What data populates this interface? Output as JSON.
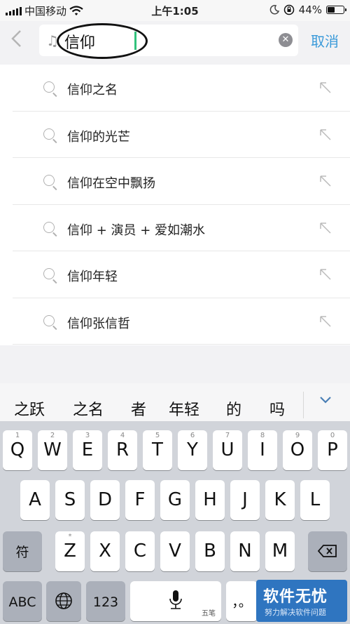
{
  "status_bar": {
    "carrier": "中国移动",
    "time": "上午1:05",
    "battery": "44%",
    "battery_level": 0.44
  },
  "search": {
    "query": "信仰",
    "cancel_label": "取消",
    "clear_icon": "clear-x-icon",
    "music_icon": "music-note-icon"
  },
  "suggestions": [
    {
      "label": "信仰之名"
    },
    {
      "label": "信仰的光芒"
    },
    {
      "label": "信仰在空中飘扬"
    },
    {
      "label": "信仰 + 演员 + 爱如潮水"
    },
    {
      "label": "信仰年轻"
    },
    {
      "label": "信仰张信哲"
    }
  ],
  "candidates": [
    "之跃",
    "之名",
    "者",
    "年轻",
    "的",
    "吗"
  ],
  "keyboard": {
    "row1": [
      {
        "k": "Q",
        "n": "1"
      },
      {
        "k": "W",
        "n": "2"
      },
      {
        "k": "E",
        "n": "3"
      },
      {
        "k": "R",
        "n": "4"
      },
      {
        "k": "T",
        "n": "5"
      },
      {
        "k": "Y",
        "n": "6"
      },
      {
        "k": "U",
        "n": "7"
      },
      {
        "k": "I",
        "n": "8"
      },
      {
        "k": "O",
        "n": "9"
      },
      {
        "k": "P",
        "n": "0"
      }
    ],
    "row2": [
      "A",
      "S",
      "D",
      "F",
      "G",
      "H",
      "J",
      "K",
      "L"
    ],
    "row3": [
      {
        "k": "Z",
        "n": "*"
      },
      {
        "k": "X",
        "n": ""
      },
      {
        "k": "C",
        "n": ""
      },
      {
        "k": "V",
        "n": ""
      },
      {
        "k": "B",
        "n": ""
      },
      {
        "k": "N",
        "n": ""
      },
      {
        "k": "M",
        "n": ""
      }
    ],
    "shift_label": "符",
    "abc_label": "ABC",
    "num_label": "123",
    "space_label": "五笔",
    "punct_label": "，。"
  },
  "watermark": {
    "title": "软件无忧",
    "subtitle": "努力解决软件问题"
  },
  "colors": {
    "accent": "#3a9ad9",
    "caret": "#31c27c",
    "keyboard_bg": "#d1d4da"
  }
}
